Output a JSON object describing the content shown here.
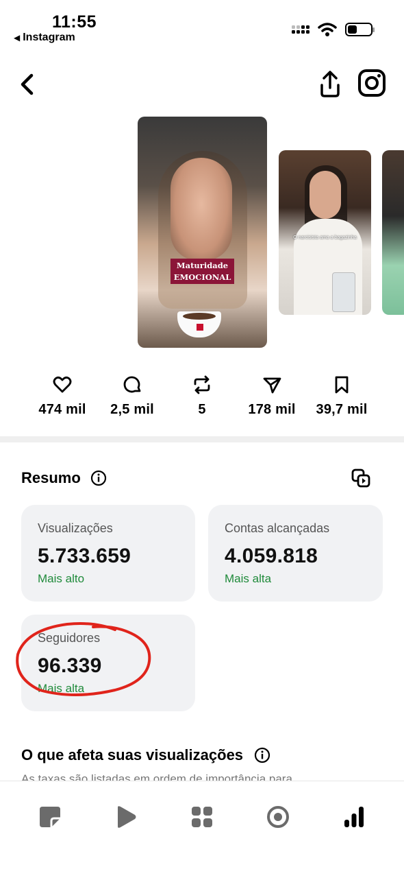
{
  "status_bar": {
    "time": "11:55",
    "back_app": "Instagram"
  },
  "header": {
    "back_icon": "chevron-left-icon",
    "share_icon": "share-icon",
    "instagram_icon": "instagram-logo-icon"
  },
  "media": {
    "main_caption_line1": "Maturidade",
    "main_caption_line2": "EMOCIONAL",
    "second_subtitle": "O narcisista ama a bagazinha"
  },
  "stats": [
    {
      "icon": "heart-icon",
      "value": "474 mil"
    },
    {
      "icon": "comment-icon",
      "value": "2,5 mil"
    },
    {
      "icon": "repost-icon",
      "value": "5"
    },
    {
      "icon": "send-icon",
      "value": "178 mil"
    },
    {
      "icon": "bookmark-icon",
      "value": "39,7 mil"
    }
  ],
  "summary": {
    "title": "Resumo",
    "cards": [
      {
        "label": "Visualizações",
        "value": "5.733.659",
        "note": "Mais alto"
      },
      {
        "label": "Contas alcançadas",
        "value": "4.059.818",
        "note": "Mais alta"
      },
      {
        "label": "Seguidores",
        "value": "96.339",
        "note": "Mais alta"
      }
    ],
    "highlight_color": "#e0241b"
  },
  "affects": {
    "title": "O que afeta suas visualizações",
    "subtitle": "As taxas são listadas em ordem de importância para"
  },
  "bottom_nav": [
    "posts-icon",
    "reels-icon",
    "grid-icon",
    "target-icon",
    "insights-icon"
  ],
  "colors": {
    "positive": "#1f8a3a",
    "card_bg": "#f1f2f4",
    "caption_bg": "#8b1538"
  }
}
